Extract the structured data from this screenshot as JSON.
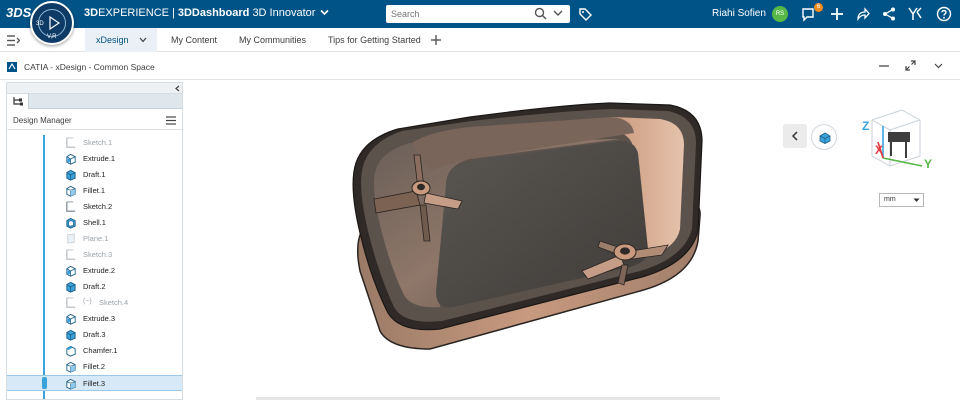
{
  "topbar": {
    "brand_logo": "3DS",
    "brand_prefix": "3D",
    "brand_experience": "EXPERIENCE",
    "brand_dashboard": "3DDashboard",
    "brand_role": "3D Innovator",
    "compass_3d": "3D",
    "compass_vr": "V,R",
    "search_placeholder": "Search",
    "user_name": "Riahi Sofien",
    "user_initials": "RS",
    "notification_count": "6"
  },
  "tabs": [
    {
      "label": "xDesign",
      "active": true
    },
    {
      "label": "My Content",
      "active": false
    },
    {
      "label": "My Communities",
      "active": false
    },
    {
      "label": "Tips for Getting Started",
      "active": false
    }
  ],
  "app": {
    "title": "CATIA - xDesign - Common Space"
  },
  "panel": {
    "title": "Design Manager"
  },
  "tree": [
    {
      "label": "Sketch.1",
      "icon": "sketch-icon",
      "dim": true
    },
    {
      "label": "Extrude.1",
      "icon": "extrude-icon",
      "dim": false
    },
    {
      "label": "Draft.1",
      "icon": "draft-icon",
      "dim": false
    },
    {
      "label": "Fillet.1",
      "icon": "fillet-icon",
      "dim": false
    },
    {
      "label": "Sketch.2",
      "icon": "sketch-icon",
      "dim": false
    },
    {
      "label": "Shell.1",
      "icon": "shell-icon",
      "dim": false
    },
    {
      "label": "Plane.1",
      "icon": "plane-icon",
      "dim": true
    },
    {
      "label": "Sketch.3",
      "icon": "sketch-icon",
      "dim": true
    },
    {
      "label": "Extrude.2",
      "icon": "extrude-icon",
      "dim": false
    },
    {
      "label": "Draft.2",
      "icon": "draft-icon",
      "dim": false
    },
    {
      "label": "Sketch.4",
      "icon": "sketch-icon",
      "dim": true,
      "hidden": true
    },
    {
      "label": "Extrude.3",
      "icon": "extrude-icon",
      "dim": false
    },
    {
      "label": "Draft.3",
      "icon": "draft-icon",
      "dim": false
    },
    {
      "label": "Chamfer.1",
      "icon": "chamfer-icon",
      "dim": false
    },
    {
      "label": "Fillet.2",
      "icon": "fillet-icon",
      "dim": false
    },
    {
      "label": "Fillet.3",
      "icon": "fillet-icon",
      "dim": false,
      "selected": true
    }
  ],
  "axes": {
    "x": "X",
    "y": "Y",
    "z": "Z"
  },
  "units": {
    "selected": "mm"
  },
  "colors": {
    "topbar": "#005386",
    "accent": "#3ba3dc",
    "part_body": "#b88a6e",
    "part_floor": "#4f4c49"
  }
}
